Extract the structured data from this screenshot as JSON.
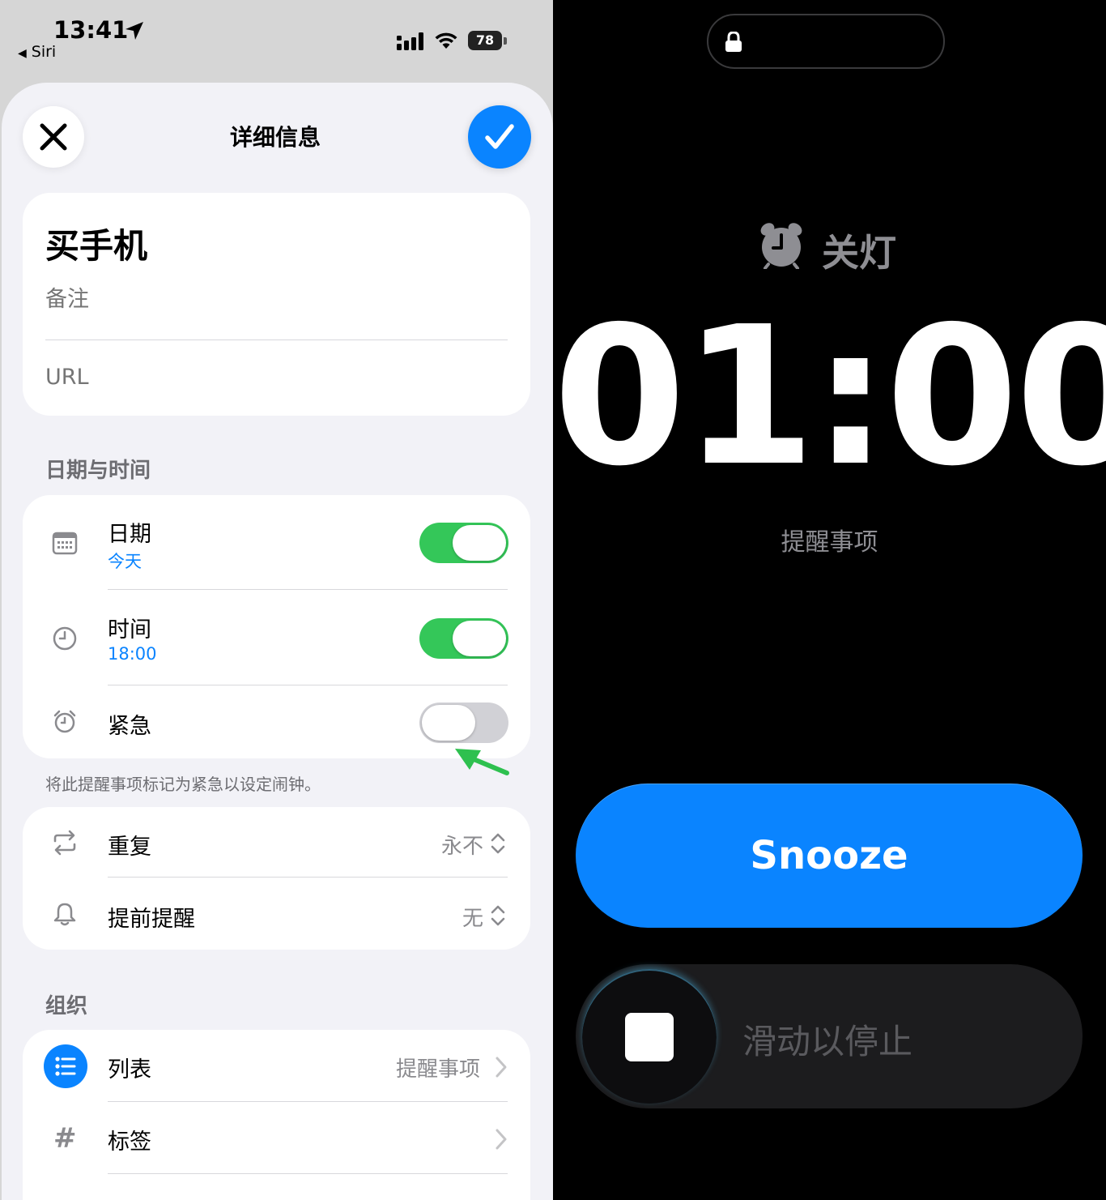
{
  "status_bar": {
    "time": "13:41",
    "back_app": "Siri",
    "battery": "78"
  },
  "sheet": {
    "title": "详细信息",
    "close_icon": "close-icon",
    "done_icon": "checkmark-icon"
  },
  "task": {
    "title": "买手机",
    "notes_placeholder": "备注",
    "url_placeholder": "URL"
  },
  "date_time": {
    "header": "日期与时间",
    "date_label": "日期",
    "date_value": "今天",
    "date_enabled": true,
    "time_label": "时间",
    "time_value": "18:00",
    "time_enabled": true,
    "urgent_label": "紧急",
    "urgent_enabled": false,
    "urgent_hint": "将此提醒事项标记为紧急以设定闹钟。"
  },
  "repeat": {
    "repeat_label": "重复",
    "repeat_value": "永不",
    "early_label": "提前提醒",
    "early_value": "无"
  },
  "organize": {
    "header": "组织",
    "list_label": "列表",
    "list_value": "提醒事项",
    "tags_label": "标签",
    "tags_icon": "#"
  },
  "alarm": {
    "label": "关灯",
    "time": "01:00",
    "subtitle": "提醒事项",
    "snooze": "Snooze",
    "slide_to_stop": "滑动以停止"
  },
  "colors": {
    "accent": "#0a84ff",
    "toggle_on": "#34c759",
    "annotation_arrow": "#2ec04f"
  }
}
